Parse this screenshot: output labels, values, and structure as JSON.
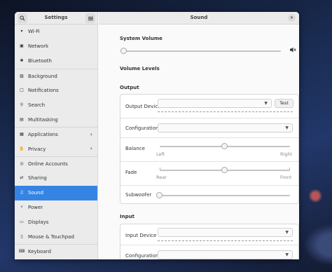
{
  "sidebar": {
    "title": "Settings",
    "search_icon": "search-icon",
    "menu_icon": "hamburger-menu-icon",
    "items": [
      {
        "label": "Wi-Fi",
        "icon": "wifi-icon",
        "glyph": "▾"
      },
      {
        "label": "Network",
        "icon": "network-icon",
        "glyph": "▣"
      },
      {
        "label": "Bluetooth",
        "icon": "bluetooth-icon",
        "glyph": "✱"
      },
      {
        "label": "Background",
        "icon": "background-icon",
        "glyph": "▧"
      },
      {
        "label": "Notifications",
        "icon": "notifications-icon",
        "glyph": "□"
      },
      {
        "label": "Search",
        "icon": "search-icon",
        "glyph": "⚲"
      },
      {
        "label": "Multitasking",
        "icon": "multitasking-icon",
        "glyph": "▤"
      },
      {
        "label": "Applications",
        "icon": "applications-icon",
        "glyph": "▦",
        "chevron": "›"
      },
      {
        "label": "Privacy",
        "icon": "privacy-icon",
        "glyph": "✋",
        "chevron": "›"
      },
      {
        "label": "Online Accounts",
        "icon": "online-accounts-icon",
        "glyph": "◎"
      },
      {
        "label": "Sharing",
        "icon": "sharing-icon",
        "glyph": "⇄"
      },
      {
        "label": "Sound",
        "icon": "sound-icon",
        "glyph": "♫"
      },
      {
        "label": "Power",
        "icon": "power-icon",
        "glyph": "⚡"
      },
      {
        "label": "Displays",
        "icon": "displays-icon",
        "glyph": "▭"
      },
      {
        "label": "Mouse & Touchpad",
        "icon": "mouse-icon",
        "glyph": "▯"
      },
      {
        "label": "Keyboard",
        "icon": "keyboard-icon",
        "glyph": "⌨"
      }
    ],
    "active_item": "Sound"
  },
  "main": {
    "title": "Sound",
    "close_icon": "close-icon",
    "system_volume": {
      "title": "System Volume",
      "level": 0.0,
      "icon": "speaker-icon"
    },
    "volume_levels": {
      "title": "Volume Levels"
    },
    "output": {
      "title": "Output",
      "device_label": "Output Device",
      "device_value": "",
      "test_label": "Test",
      "configuration_label": "Configuration",
      "configuration_value": "",
      "balance_label": "Balance",
      "balance_left": "Left",
      "balance_right": "Right",
      "balance_value": 0.5,
      "fade_label": "Fade",
      "fade_rear": "Rear",
      "fade_front": "Front",
      "fade_value": 0.5,
      "subwoofer_label": "Subwoofer",
      "subwoofer_value": 0.0
    },
    "input": {
      "title": "Input",
      "device_label": "Input Device",
      "device_value": "",
      "configuration_label": "Configuration",
      "configuration_value": ""
    }
  },
  "colors": {
    "accent": "#3584e4",
    "sidebar_bg": "#ebebeb",
    "window_bg": "#fafafa"
  }
}
